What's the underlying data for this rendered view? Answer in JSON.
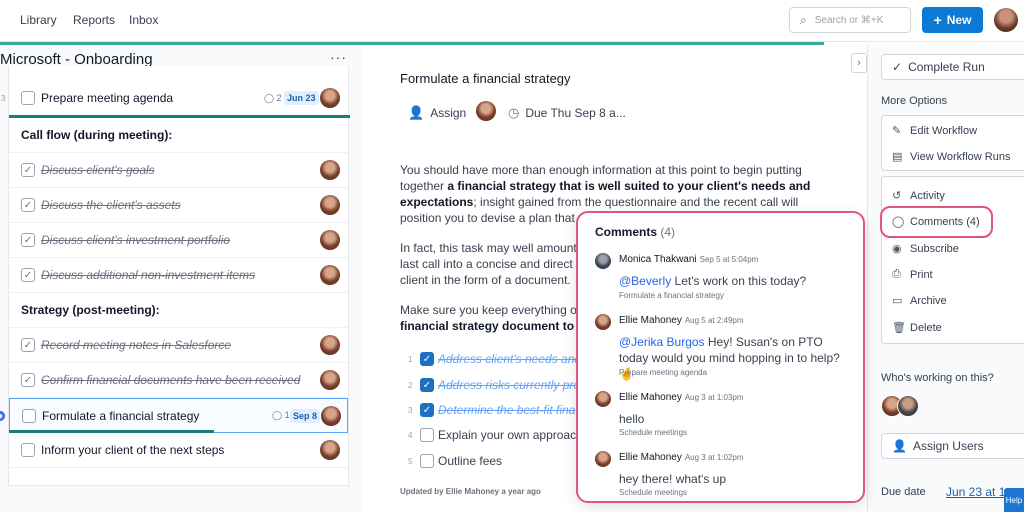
{
  "topbar": {
    "nav": [
      "Library",
      "Reports",
      "Inbox"
    ],
    "search_placeholder": "Search or ⌘+K",
    "new_label": "New"
  },
  "workflow": {
    "title": "Microsoft - Onboarding",
    "menu_label": "···",
    "tasks": [
      {
        "num": "3",
        "label": "Prepare meeting agenda",
        "comments": "2",
        "due": "Jun 23"
      },
      {
        "label": "Call flow (during meeting):"
      },
      {
        "label": "Discuss client's goals"
      },
      {
        "label": "Discuss the client's assets"
      },
      {
        "label": "Discuss client's investment portfolio"
      },
      {
        "label": "Discuss additional non-investment items"
      },
      {
        "label": "Strategy (post-meeting):"
      },
      {
        "label": "Record meeting notes in Salesforce"
      },
      {
        "label": "Confirm financial documents have been received"
      },
      {
        "label": "Formulate a financial strategy",
        "comments": "1",
        "due": "Sep 8"
      },
      {
        "label": "Inform your client of the next steps"
      }
    ]
  },
  "task": {
    "title": "Formulate a financial strategy",
    "assign_label": "Assign",
    "due_label": "Due Thu Sep 8 a...",
    "p1_a": "You should have more than enough information at this point to begin putting together ",
    "p1_b": "a financial strategy that is well suited to your client's needs and expectations",
    "p1_c": "; insight gained from the questionnaire and the recent call will position you to devise a plan that directly a",
    "p2": "In fact, this task may well amount to last call into a concise and direct s client in the form of a document.",
    "p3_a": "Make sure you keep everything org",
    "p3_b": "financial strategy document to th",
    "subtasks": [
      {
        "n": "1",
        "text": "Address client's needs and"
      },
      {
        "n": "2",
        "text": "Address risks currently pre"
      },
      {
        "n": "3",
        "text": "Determine the best-fit fina"
      },
      {
        "n": "4",
        "text": "Explain your own approach"
      },
      {
        "n": "5",
        "text": "Outline fees"
      }
    ],
    "updated": "Updated by Ellie Mahoney a year ago"
  },
  "sidebar": {
    "complete_run": "Complete Run",
    "more_options": "More Options",
    "options": [
      {
        "icon": "✎",
        "label": "Edit Workflow"
      },
      {
        "icon": "▤",
        "label": "View Workflow Runs"
      },
      {
        "icon": "↺",
        "label": "Activity"
      },
      {
        "icon": "◯",
        "label": "Comments (4)"
      },
      {
        "icon": "◉",
        "label": "Subscribe"
      },
      {
        "icon": "⎙",
        "label": "Print"
      },
      {
        "icon": "▭",
        "label": "Archive"
      },
      {
        "icon": "🗑",
        "label": "Delete"
      }
    ],
    "whos_working": "Who's working on this?",
    "assign_users": "Assign Users",
    "due_date_label": "Due date",
    "due_date_value": "Jun 23 at 1",
    "help": "Help"
  },
  "comments": {
    "title": "Comments",
    "count": "(4)",
    "items": [
      {
        "author": "Monica Thakwani",
        "time": "Sep 5 at 5:04pm",
        "mention": "@Beverly",
        "body": " Let's work on this today?",
        "context": "Formulate a financial strategy"
      },
      {
        "author": "Ellie Mahoney",
        "time": "Aug 5 at 2:49pm",
        "mention": "@Jerika Burgos",
        "body": " Hey! Susan's on PTO today would you mind hopping in to help? 🤞",
        "context": "Prepare meeting agenda"
      },
      {
        "author": "Ellie Mahoney",
        "time": "Aug 3 at 1:03pm",
        "mention": "",
        "body": "hello",
        "context": "Schedule meetings"
      },
      {
        "author": "Ellie Mahoney",
        "time": "Aug 3 at 1:02pm",
        "mention": "",
        "body": "hey there! what's up",
        "context": "Schedule meetings"
      }
    ]
  }
}
